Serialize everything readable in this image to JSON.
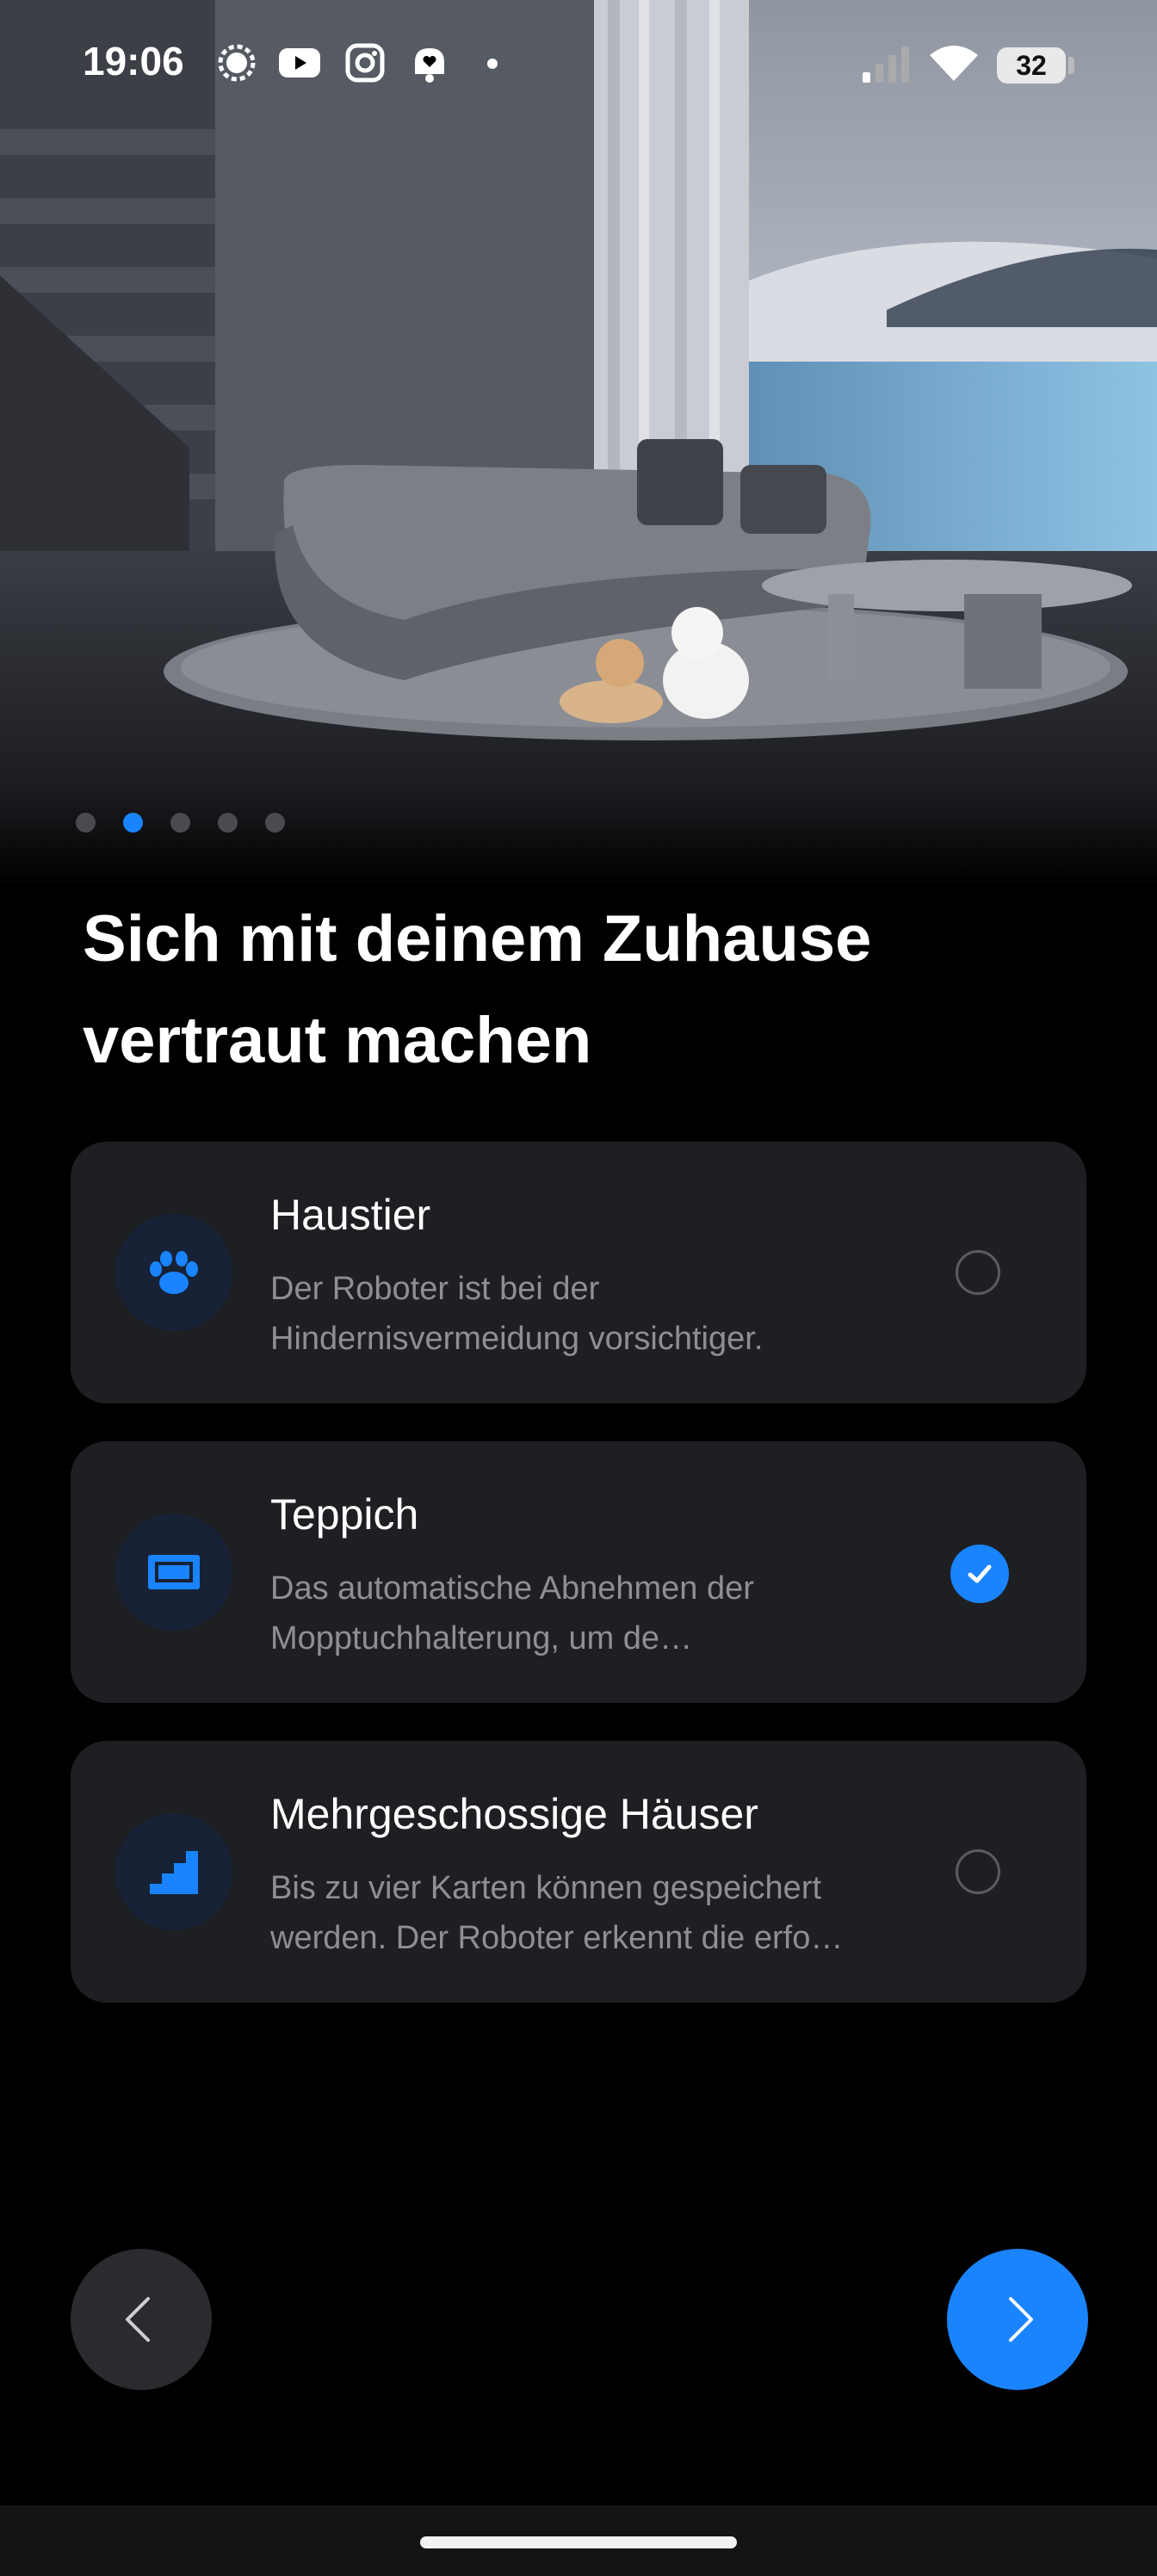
{
  "status_bar": {
    "time": "19:06",
    "battery": "32",
    "notification_icons": [
      "signal-chat-icon",
      "youtube-icon",
      "instagram-icon",
      "bell-heart-icon",
      "dot-icon"
    ],
    "system_icons": [
      "cellular-signal-icon",
      "wifi-icon",
      "battery-icon"
    ]
  },
  "pager": {
    "total": 5,
    "active_index": 1
  },
  "title": "Sich mit deinem Zuhause vertraut machen",
  "options": [
    {
      "title": "Haustier",
      "description": "Der Roboter ist bei der Hindernisvermeidung vorsichtiger.",
      "icon": "paw-icon",
      "checked": false
    },
    {
      "title": "Teppich",
      "description": "Das automatische Abnehmen der Mopptuchhalterung, um de…",
      "icon": "carpet-icon",
      "checked": true
    },
    {
      "title": "Mehrgeschossige Häuser",
      "description": "Bis zu vier Karten können gespeichert werden. Der Roboter erkennt die erfo…",
      "icon": "stairs-icon",
      "checked": false
    }
  ],
  "navigation": {
    "prev_icon": "chevron-left-icon",
    "next_icon": "chevron-right-icon"
  },
  "colors": {
    "accent": "#1a84ff",
    "card_bg": "#1e1f22",
    "background": "#000000"
  }
}
